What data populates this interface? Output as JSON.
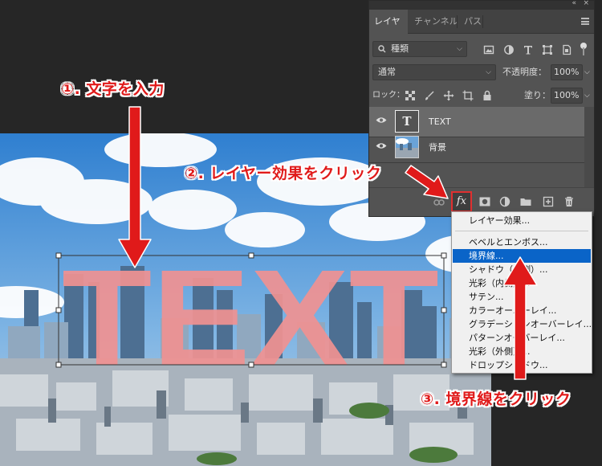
{
  "canvas": {
    "text_layer_content": "TEXT",
    "text_color": "#f09191"
  },
  "panel": {
    "collapse_icon": "«",
    "close_icon": "×",
    "tabs": [
      "レイヤー",
      "チャンネル",
      "パス"
    ],
    "filter_kind": "種類",
    "blend_mode": "通常",
    "opacity_label": "不透明度：",
    "opacity_value": "100%",
    "lock_label": "ロック：",
    "fill_label": "塗り：",
    "fill_value": "100%",
    "layers": [
      {
        "name": "TEXT",
        "type": "text",
        "visible": true,
        "selected": true
      },
      {
        "name": "背景",
        "type": "image",
        "visible": true,
        "selected": false
      }
    ],
    "fx_label": "fx"
  },
  "dropdown": {
    "items": [
      {
        "label": "レイヤー効果..."
      },
      {
        "label": "ベベルとエンボス..."
      },
      {
        "label": "境界線...",
        "highlighted": true
      },
      {
        "label": "シャドウ（内側）..."
      },
      {
        "label": "光彩（内側）..."
      },
      {
        "label": "サテン..."
      },
      {
        "label": "カラーオーバーレイ..."
      },
      {
        "label": "グラデーションオーバーレイ..."
      },
      {
        "label": "パターンオーバーレイ..."
      },
      {
        "label": "光彩（外側）..."
      },
      {
        "label": "ドロップシャドウ..."
      }
    ]
  },
  "annotations": {
    "step1": "①. 文字を入力",
    "step2": "②. レイヤー効果をクリック",
    "step3": "③. 境界線をクリック",
    "color": "#e01a1a"
  },
  "colors": {
    "app_bg": "#262626",
    "panel_bg": "#535353",
    "menu_highlight": "#0a64c8"
  }
}
